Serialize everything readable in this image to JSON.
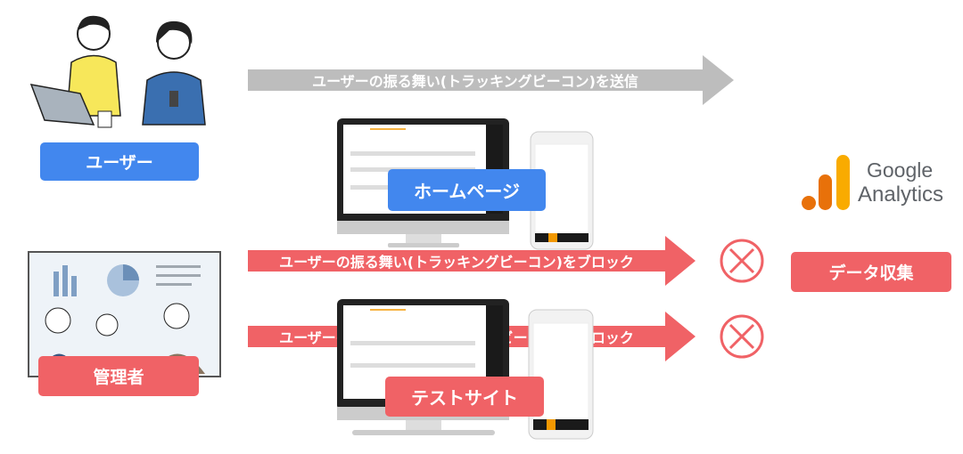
{
  "colors": {
    "blue": "#4287ee",
    "red": "#f06266",
    "gray": "#bdbdbd",
    "ga_orange_light": "#f9ab00",
    "ga_orange_dark": "#e8710a"
  },
  "top_arrow": {
    "text": "ユーザーの振る舞い(トラッキングビーコン)を送信",
    "icon": "arrow-right"
  },
  "block_arrows": [
    {
      "text": "ユーザーの振る舞い(トラッキングビーコン)をブロック",
      "icon": "blocked-x-circle"
    },
    {
      "text": "ユーザーの振る舞い(トラッキングビーコン)をブロック",
      "icon": "blocked-x-circle"
    }
  ],
  "labels": {
    "user": "ユーザー",
    "homepage": "ホームページ",
    "admin": "管理者",
    "test_site": "テストサイト",
    "data_collection": "データ収集"
  },
  "logo": {
    "brand_line1": "Google",
    "brand_line2": "Analytics"
  }
}
